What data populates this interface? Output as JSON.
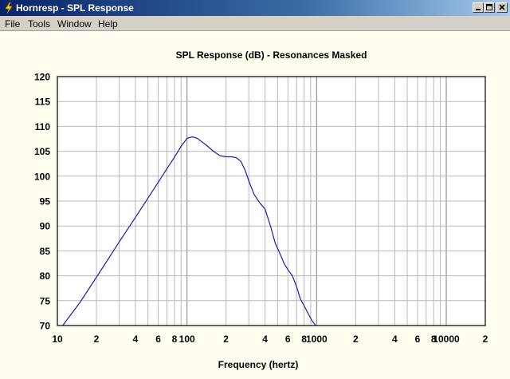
{
  "window": {
    "title": "Hornresp - SPL Response",
    "buttons": {
      "minimize": "minimize",
      "maximize": "maximize",
      "close": "close"
    }
  },
  "menu": {
    "items": [
      {
        "label": "File"
      },
      {
        "label": "Tools"
      },
      {
        "label": "Window"
      },
      {
        "label": "Help"
      }
    ]
  },
  "colors": {
    "background": "#FFFEF0",
    "plot_background": "#FFFFFF",
    "grid": "#B8B8B8",
    "grid_decade": "#808080",
    "curve": "#1A1AAF",
    "titlebar": "#0A246A"
  },
  "chart_data": {
    "type": "line",
    "title": "SPL Response (dB) - Resonances Masked",
    "xlabel": "Frequency (hertz)",
    "ylabel": "",
    "x_scale": "log",
    "xlim": [
      10,
      20000
    ],
    "ylim": [
      70,
      120
    ],
    "grid": true,
    "y_ticks": [
      70,
      75,
      80,
      85,
      90,
      95,
      100,
      105,
      110,
      115,
      120
    ],
    "x_tick_labels": [
      {
        "value": 10,
        "label": "10"
      },
      {
        "value": 20,
        "label": "2"
      },
      {
        "value": 40,
        "label": "4"
      },
      {
        "value": 60,
        "label": "6"
      },
      {
        "value": 80,
        "label": "8"
      },
      {
        "value": 100,
        "label": "100"
      },
      {
        "value": 200,
        "label": "2"
      },
      {
        "value": 400,
        "label": "4"
      },
      {
        "value": 600,
        "label": "6"
      },
      {
        "value": 800,
        "label": "8"
      },
      {
        "value": 1000,
        "label": "1000"
      },
      {
        "value": 2000,
        "label": "2"
      },
      {
        "value": 4000,
        "label": "4"
      },
      {
        "value": 6000,
        "label": "6"
      },
      {
        "value": 8000,
        "label": "8"
      },
      {
        "value": 10000,
        "label": "10000"
      },
      {
        "value": 20000,
        "label": "2"
      }
    ],
    "series": [
      {
        "x": [
          10,
          11,
          15,
          20,
          30,
          40,
          50,
          60,
          70,
          80,
          90,
          100,
          110,
          120,
          140,
          160,
          180,
          200,
          220,
          240,
          260,
          280,
          300,
          330,
          360,
          400,
          440,
          480,
          520,
          560,
          600,
          650,
          700,
          750,
          800,
          860,
          920,
          970,
          1000
        ],
        "y": [
          69.0,
          70.0,
          74.7,
          79.7,
          86.8,
          91.7,
          95.6,
          98.8,
          101.5,
          103.8,
          106.0,
          107.6,
          107.9,
          107.6,
          106.3,
          105.0,
          104.1,
          103.9,
          103.9,
          103.7,
          103.0,
          101.3,
          99.0,
          96.3,
          94.8,
          93.4,
          90.0,
          86.5,
          84.5,
          82.5,
          81.2,
          80.0,
          77.8,
          75.3,
          74.0,
          72.4,
          71.0,
          70.2,
          69.6
        ]
      }
    ]
  }
}
